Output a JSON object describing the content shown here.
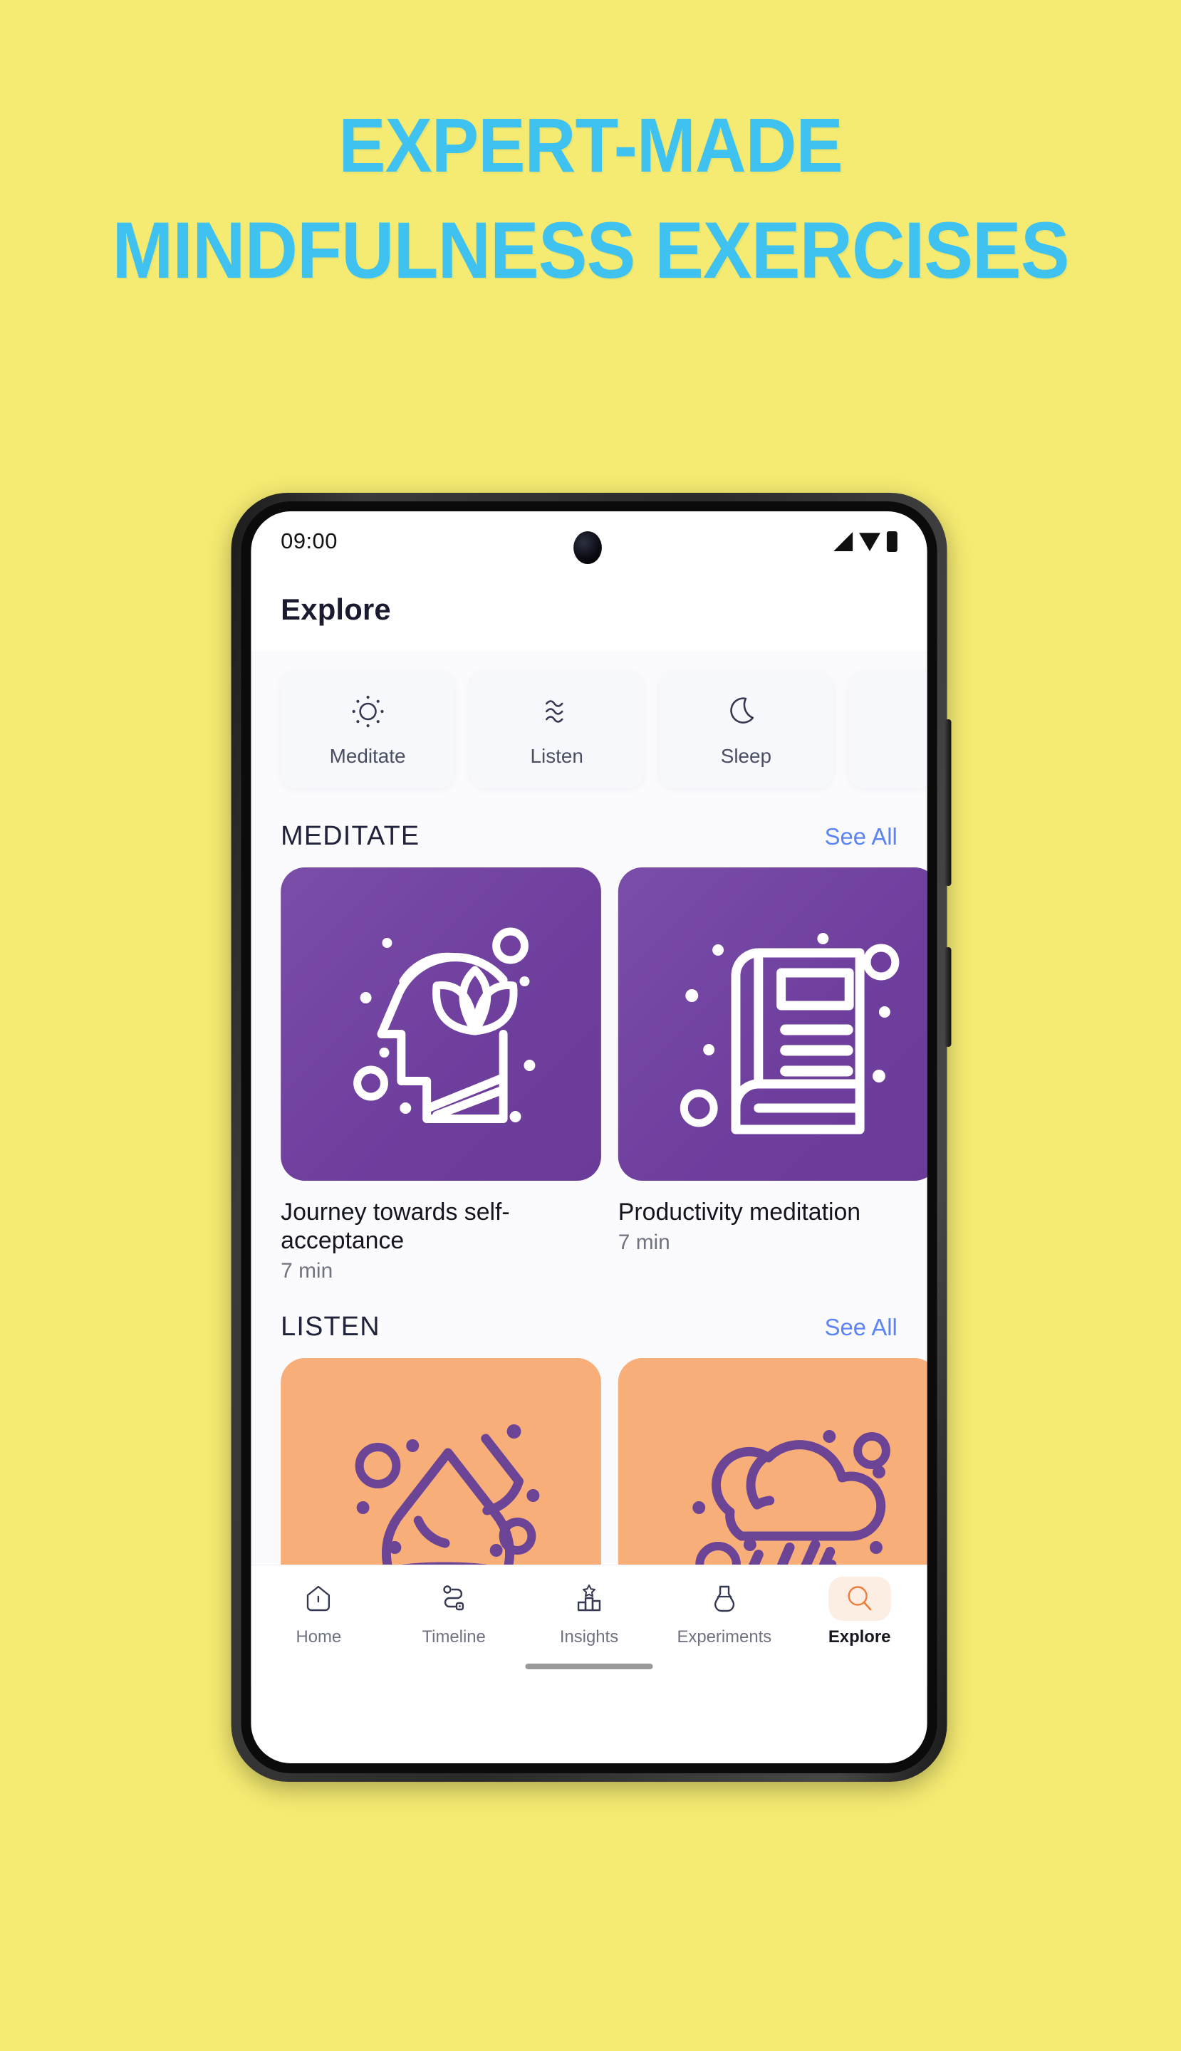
{
  "promo": {
    "background_color": "#f5eb72",
    "accent_color": "#3fc2ef",
    "headline_line1": "EXPERT-MADE",
    "headline_line2": "MINDFULNESS EXERCISES"
  },
  "phone": {
    "status_bar": {
      "time": "09:00",
      "icons": [
        "signal-icon",
        "wifi-icon",
        "battery-icon"
      ]
    },
    "home_indicator": "home-indicator"
  },
  "app": {
    "header": {
      "title": "Explore"
    },
    "chips": [
      {
        "label": "Meditate",
        "icon": "sun-icon"
      },
      {
        "label": "Listen",
        "icon": "waves-icon"
      },
      {
        "label": "Sleep",
        "icon": "moon-icon"
      }
    ],
    "sections": [
      {
        "title": "MEDITATE",
        "see_all": "See All",
        "card_color": "#6f3f9e",
        "cards": [
          {
            "title": "Journey towards self-acceptance",
            "duration": "7 min",
            "art": "head-lotus-icon"
          },
          {
            "title": "Productivity meditation",
            "duration": "7 min",
            "art": "book-icon"
          }
        ]
      },
      {
        "title": "LISTEN",
        "see_all": "See All",
        "card_color": "#f8ae79",
        "cards": [
          {
            "title": "",
            "duration": "",
            "art": "water-drop-icon"
          },
          {
            "title": "",
            "duration": "",
            "art": "rain-cloud-icon"
          }
        ]
      }
    ],
    "bottom_nav": {
      "active": "Explore",
      "items": [
        {
          "label": "Home",
          "icon": "home-icon"
        },
        {
          "label": "Timeline",
          "icon": "timeline-icon"
        },
        {
          "label": "Insights",
          "icon": "insights-icon"
        },
        {
          "label": "Experiments",
          "icon": "flask-icon"
        },
        {
          "label": "Explore",
          "icon": "search-icon"
        }
      ]
    }
  }
}
